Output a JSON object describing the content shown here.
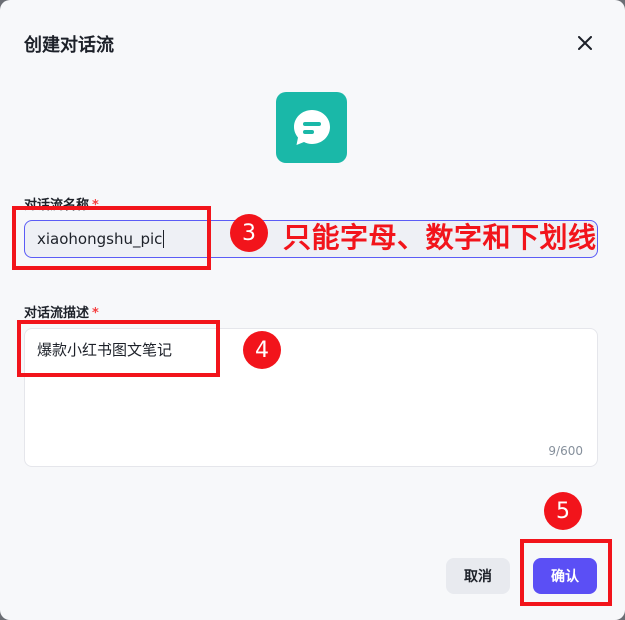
{
  "dialog": {
    "title": "创建对话流",
    "close_icon": "close-icon",
    "app_icon": "chat-bubble-icon",
    "accent_color": "#5b4ff5",
    "icon_color": "#1ab8a8"
  },
  "form": {
    "name_label": "对话流名称",
    "name_required_mark": "*",
    "name_value": "xiaohongshu_pic",
    "desc_label": "对话流描述",
    "desc_required_mark": "*",
    "desc_value": "爆款小红书图文笔记",
    "desc_counter": "9/600"
  },
  "buttons": {
    "cancel_label": "取消",
    "confirm_label": "确认"
  },
  "annotations": {
    "step3": "3",
    "step3_note": "只能字母、数字和下划线",
    "step4": "4",
    "step5": "5",
    "highlight_color": "#f2141b"
  }
}
